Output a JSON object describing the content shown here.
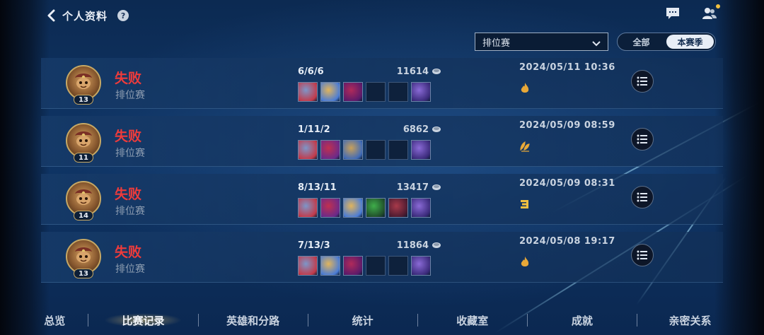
{
  "header": {
    "title": "个人资料",
    "help_glyph": "?"
  },
  "filters": {
    "mode_selected": "排位赛",
    "season_all": "全部",
    "season_current": "本赛季"
  },
  "matches": [
    {
      "result": "失败",
      "mode": "排位赛",
      "level": "13",
      "kda": "6/6/6",
      "gold": "11614",
      "datetime": "2024/05/11 10:36",
      "badge": "flame-icon",
      "items": [
        "item-tank-helm",
        "item-orb-gear",
        "item-crimson-claw",
        "",
        "",
        "item-purple-boots"
      ]
    },
    {
      "result": "失败",
      "mode": "排位赛",
      "level": "11",
      "kda": "1/11/2",
      "gold": "6862",
      "datetime": "2024/05/09 08:59",
      "badge": "leaf-icon",
      "items": [
        "item-tank-helm",
        "item-crimson-blade",
        "item-scroll-gear",
        "",
        "",
        "item-purple-boots"
      ]
    },
    {
      "result": "失败",
      "mode": "排位赛",
      "level": "14",
      "kda": "8/13/11",
      "gold": "13417",
      "datetime": "2024/05/09 08:31",
      "badge": "rank-three-icon",
      "items": [
        "item-tank-helm",
        "item-crimson-blade",
        "item-orb-gear",
        "item-green-orb",
        "item-crimson-hat",
        "item-purple-boots"
      ]
    },
    {
      "result": "失败",
      "mode": "排位赛",
      "level": "13",
      "kda": "7/13/3",
      "gold": "11864",
      "datetime": "2024/05/08 19:17",
      "badge": "flame-icon",
      "items": [
        "item-tank-helm",
        "item-orb-gear",
        "item-crimson-claw",
        "",
        "",
        "item-purple-boots"
      ]
    }
  ],
  "bottom_nav": [
    "总览",
    "比赛记录",
    "英雄和分路",
    "统计",
    "收藏室",
    "成就",
    "亲密关系"
  ],
  "bottom_nav_active": 1,
  "colors": {
    "defeat": "#ee3b3b",
    "accent_gold": "#c7a864",
    "background": "#0f3566"
  }
}
